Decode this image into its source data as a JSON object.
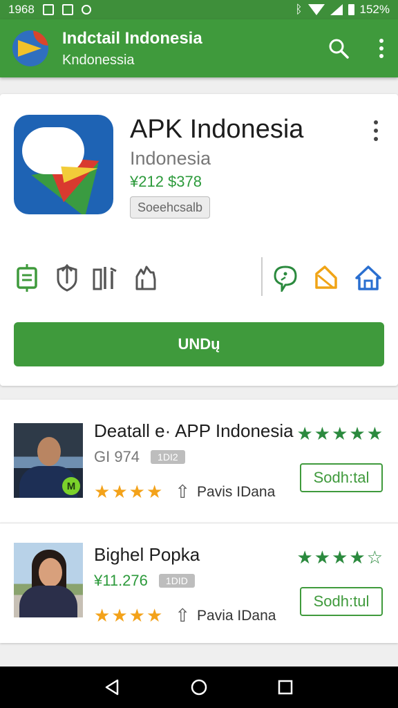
{
  "status_bar": {
    "time": "1968",
    "battery": "152%",
    "right_icons": [
      "bluetooth-icon",
      "wifi-icon",
      "signal-icon",
      "battery-icon"
    ],
    "left_icons": [
      "screenshot-icon",
      "gallery-icon",
      "location-icon"
    ]
  },
  "app_bar": {
    "title": "Indctail Indonesia",
    "subtitle": "Kndonessia",
    "actions": [
      "search-icon",
      "more-vert-icon"
    ]
  },
  "hero": {
    "name": "APK Indonesia",
    "developer": "Indonesia",
    "price": "¥212 $378",
    "badge": "Soeehcsalb",
    "icons": [
      "document-icon",
      "upload-shield-icon",
      "chart-bars-icon",
      "hand-icon",
      "chat-bubble-icon",
      "tag-icon",
      "home-icon"
    ],
    "install_label": "UNDų"
  },
  "list": [
    {
      "title": "Deatall e· APP Indonesia",
      "meta_value": "GI 974",
      "tag": "1DI2",
      "dev_name": "Pavis IDana",
      "button_label": "Sodh:tal",
      "accent": "#2c9a3b"
    },
    {
      "title": "Bighel Popka",
      "meta_value": "¥11.276",
      "tag": "1DID",
      "dev_name": "Pavia IDana",
      "button_label": "Sodh:tul",
      "accent": "#2c9a3b"
    }
  ],
  "nav": [
    "back-icon",
    "home-icon",
    "recents-icon"
  ],
  "colors": {
    "primary": "#3f9a3c",
    "star_gold": "#f3a21a",
    "star_green": "#2b8a3e"
  }
}
